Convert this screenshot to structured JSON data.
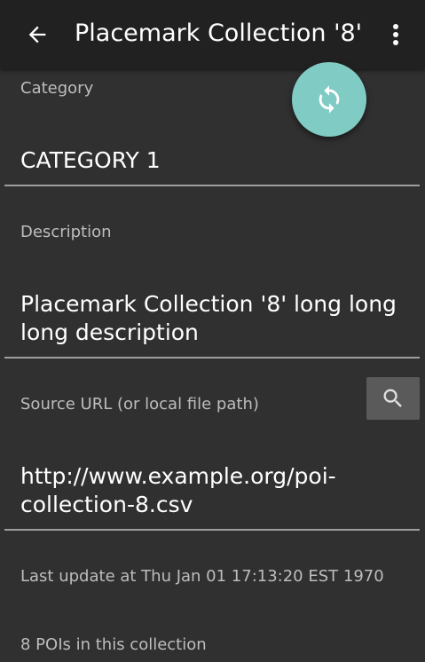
{
  "app_bar": {
    "title": "Placemark Collection '8'",
    "back_icon": "arrow-back-icon",
    "menu_icon": "more-vert-icon"
  },
  "fab": {
    "icon": "sync-icon",
    "color": "#80cbc4"
  },
  "form": {
    "category": {
      "label": "Category",
      "value": "CATEGORY 1"
    },
    "description": {
      "label": "Description",
      "value_lines": [
        "Placemark Collection '8' long long",
        "long description"
      ]
    },
    "source_url": {
      "label": "Source URL (or local file path)",
      "value_lines": [
        "http://www.example.org/poi-",
        "collection-8.csv"
      ],
      "search_icon": "search-icon"
    }
  },
  "status": {
    "last_update": "Last update at Thu Jan 01 17:13:20 EST 1970",
    "poi_count": "8 POIs in this collection"
  }
}
